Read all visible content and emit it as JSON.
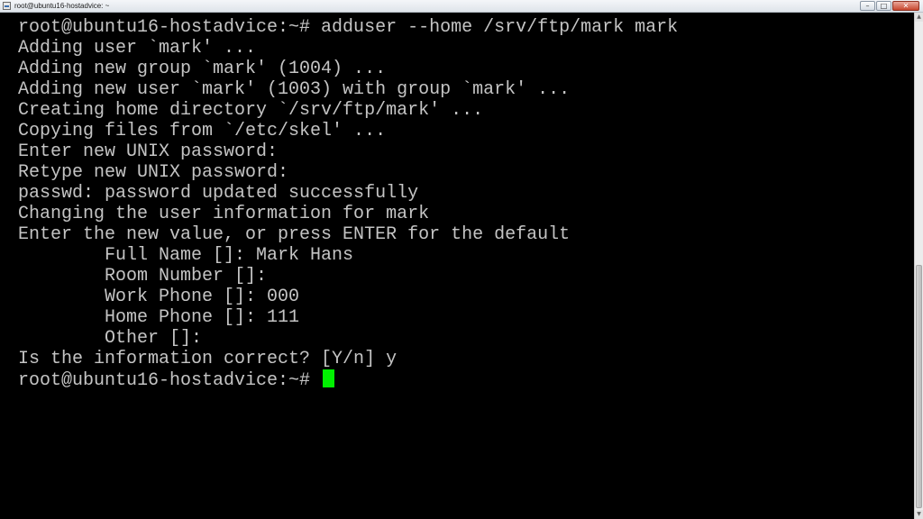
{
  "window": {
    "title": "root@ubuntu16-hostadvice: ~",
    "minimize_label": "–",
    "maximize_label": "□",
    "close_label": "✕"
  },
  "terminal": {
    "lines": [
      "root@ubuntu16-hostadvice:~# adduser --home /srv/ftp/mark mark",
      "Adding user `mark' ...",
      "Adding new group `mark' (1004) ...",
      "Adding new user `mark' (1003) with group `mark' ...",
      "Creating home directory `/srv/ftp/mark' ...",
      "Copying files from `/etc/skel' ...",
      "Enter new UNIX password:",
      "Retype new UNIX password:",
      "passwd: password updated successfully",
      "Changing the user information for mark",
      "Enter the new value, or press ENTER for the default",
      "        Full Name []: Mark Hans",
      "        Room Number []:",
      "        Work Phone []: 000",
      "        Home Phone []: 111",
      "        Other []:",
      "Is the information correct? [Y/n] y"
    ],
    "prompt": "root@ubuntu16-hostadvice:~#",
    "cursor_color": "#00f000",
    "text_color": "#c4c4c4",
    "background_color": "#000000"
  },
  "icons": {
    "app": "putty-terminal-icon",
    "scroll_up": "arrow-up-icon",
    "scroll_down": "arrow-down-icon"
  }
}
